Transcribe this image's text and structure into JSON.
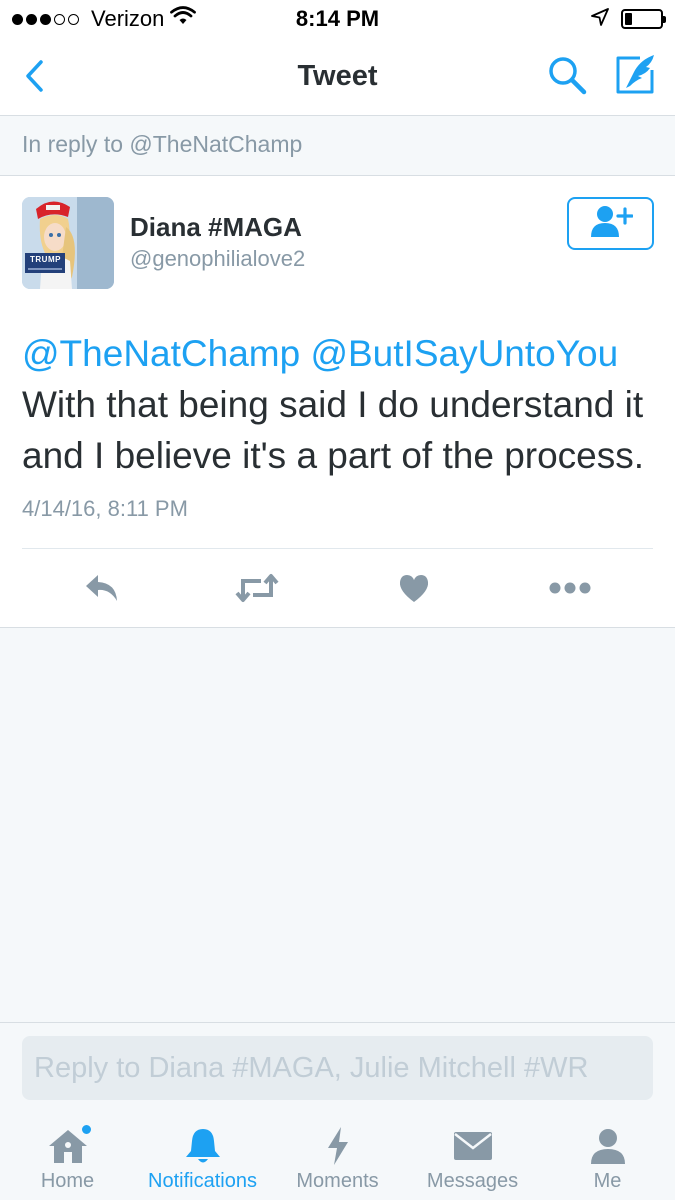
{
  "status_bar": {
    "carrier": "Verizon",
    "time": "8:14 PM",
    "signal_bars_filled": 3,
    "signal_bars_total": 5,
    "battery_level": 0.2
  },
  "nav": {
    "title": "Tweet",
    "back_icon": "chevron-left-icon",
    "search_icon": "search-icon",
    "compose_icon": "compose-icon"
  },
  "reply_context": "In reply to @TheNatChamp",
  "tweet": {
    "display_name": "Diana #MAGA",
    "handle": "@genophilialove2",
    "avatar_badge": "TRUMP",
    "mentions": "@TheNatChamp @ButISayUntoYou",
    "body": "With that being said I do understand it and I believe it's a part of the process.",
    "timestamp": "4/14/16, 8:11 PM",
    "follow_icon": "add-user-icon",
    "actions": [
      "reply-icon",
      "retweet-icon",
      "like-icon",
      "more-icon"
    ]
  },
  "composer": {
    "placeholder": "Reply to Diana #MAGA, Julie Mitchell #WR",
    "value": ""
  },
  "tabs": [
    {
      "label": "Home",
      "icon": "home-icon",
      "active": false,
      "has_dot": true
    },
    {
      "label": "Notifications",
      "icon": "bell-icon",
      "active": true,
      "has_dot": false
    },
    {
      "label": "Moments",
      "icon": "lightning-icon",
      "active": false,
      "has_dot": false
    },
    {
      "label": "Messages",
      "icon": "envelope-icon",
      "active": false,
      "has_dot": false
    },
    {
      "label": "Me",
      "icon": "person-icon",
      "active": false,
      "has_dot": false
    }
  ],
  "colors": {
    "accent": "#1da1f2",
    "muted": "#8899a6",
    "background": "#f5f8fa"
  }
}
